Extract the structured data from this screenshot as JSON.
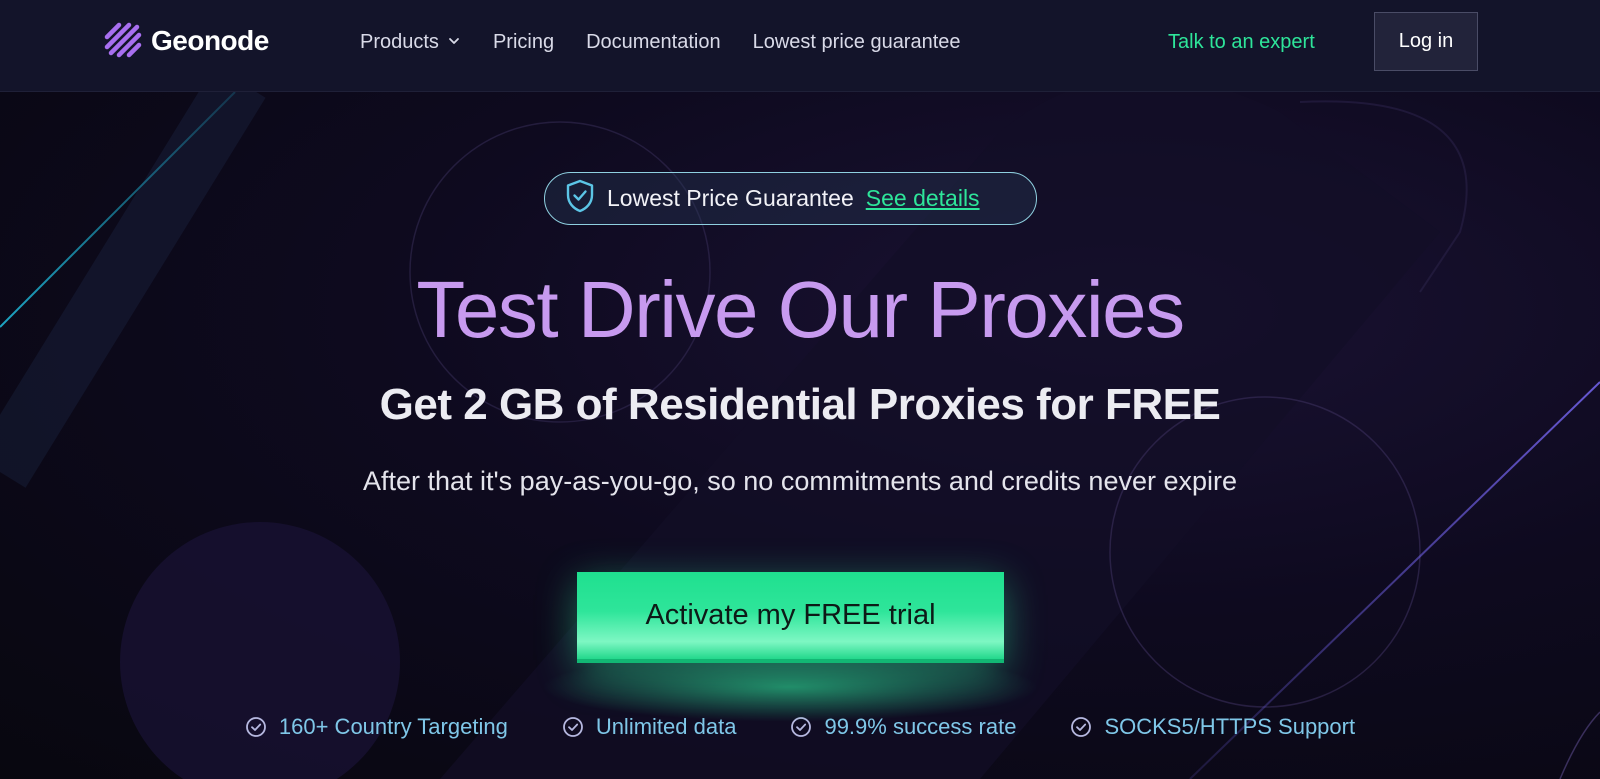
{
  "brand": {
    "name": "Geonode",
    "logo_icon": "diagonal-stripes-logo-icon",
    "accent_color": "#a86ff0"
  },
  "nav": {
    "links": [
      {
        "label": "Products",
        "has_dropdown": true
      },
      {
        "label": "Pricing"
      },
      {
        "label": "Documentation"
      },
      {
        "label": "Lowest price guarantee"
      }
    ],
    "talk_label": "Talk to an expert",
    "login_label": "Log in"
  },
  "hero": {
    "badge_text": "Lowest Price Guarantee",
    "badge_link": "See details",
    "badge_icon": "shield-check-icon",
    "headline": "Test Drive Our Proxies",
    "subheadline": "Get 2 GB of Residential Proxies for FREE",
    "description": "After that it's pay-as-you-go, so no commitments and credits never expire",
    "cta_label": "Activate my FREE trial",
    "cta_color": "#2ee59a"
  },
  "features": [
    {
      "label": "160+ Country Targeting",
      "icon": "check-circle-icon"
    },
    {
      "label": "Unlimited data",
      "icon": "check-circle-icon"
    },
    {
      "label": "99.9% success rate",
      "icon": "check-circle-icon"
    },
    {
      "label": "SOCKS5/HTTPS Support",
      "icon": "check-circle-icon"
    }
  ],
  "colors": {
    "nav_bg": "#13142a",
    "page_bg": "#0b0916",
    "headline": "#c79aef",
    "link_green": "#2ee59a",
    "feature_text": "#7fc7e8"
  }
}
